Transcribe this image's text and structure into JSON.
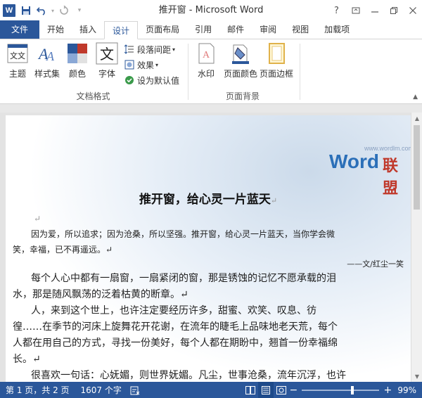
{
  "window": {
    "title": "推开窗 - Microsoft Word",
    "help_label": "?",
    "logo_letter": "W"
  },
  "tabs": [
    {
      "label": "文件"
    },
    {
      "label": "开始"
    },
    {
      "label": "插入"
    },
    {
      "label": "设计"
    },
    {
      "label": "页面布局"
    },
    {
      "label": "引用"
    },
    {
      "label": "邮件"
    },
    {
      "label": "审阅"
    },
    {
      "label": "视图"
    },
    {
      "label": "加载项"
    }
  ],
  "ribbon": {
    "doc_format": {
      "group_label": "文档格式",
      "theme": "主题",
      "style_set": "样式集",
      "colors": "颜色",
      "fonts": "字体",
      "paragraph_spacing": "段落间距",
      "effects": "效果",
      "set_default": "设为默认值",
      "theme_icon_text": "文文",
      "fonts_icon_text": "文"
    },
    "page_background": {
      "group_label": "页面背景",
      "watermark": "水印",
      "page_color": "页面颜色",
      "page_borders": "页面边框"
    }
  },
  "document": {
    "watermark_url": "www.wordlm.com",
    "watermark_word": "Word",
    "watermark_union": "联盟",
    "title": "推开窗，给心灵一片蓝天",
    "para_mark": "↵",
    "lines": [
      "因为爱，所以追求；因为沧桑，所以坚强。推开窗，给心灵一片蓝天，当你学会微",
      "笑，幸福，已不再遥远。↵",
      "——文/红尘一笑",
      "每个人心中都有一扇窗，一扇紧闭的窗，那是锈蚀的记忆不愿承载的泪",
      "水，那是随风飘荡的泛着枯黄的断章。↵",
      "人，来到这个世上，也许注定要经历许多，甜蜜、欢笑、叹息、彷",
      "徨……在季节的河床上旋舞花开花谢，在流年的睫毛上品味地老天荒，每个",
      "人都在用自己的方式，寻找一份美好，每个人都在期盼中，翘首一份幸福绵",
      "长。↵",
      "很喜欢一句话：心妩媚，则世界妩媚。凡尘，世事沧桑，流年沉浮，也许"
    ]
  },
  "status": {
    "page": "第 1 页，共 2 页",
    "words": "1607 个字",
    "zoom": "99%",
    "zoom_fraction": 0.66,
    "minus": "−",
    "plus": "+"
  },
  "colors": {
    "accent": "#2b579a",
    "watermark_blue": "#2b6fb8",
    "watermark_red": "#c0392b"
  }
}
